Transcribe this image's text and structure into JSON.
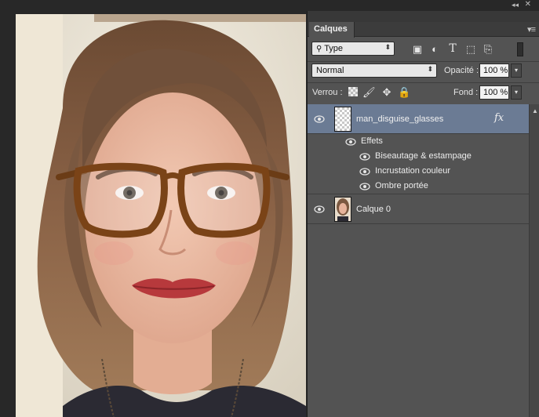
{
  "panel": {
    "tab_label": "Calques",
    "filter": {
      "kind_value": "Type"
    },
    "blend_mode": "Normal",
    "opacity_label": "Opacité :",
    "opacity_value": "100 %",
    "lock_label": "Verrou :",
    "fill_label": "Fond :",
    "fill_value": "100 %"
  },
  "layers": [
    {
      "name": "man_disguise_glasses",
      "selected": true,
      "has_fx": true,
      "fx_label": "fx",
      "effects_label": "Effets",
      "effects": [
        "Biseautage & estampage",
        "Incrustation couleur",
        "Ombre portée"
      ]
    },
    {
      "name": "Calque 0",
      "selected": false,
      "has_fx": false
    }
  ],
  "colors": {
    "panel_bg": "#535353",
    "selected_row": "#6b7b94",
    "app_bg": "#282828"
  },
  "icons": [
    "collapse-icon",
    "close-icon",
    "panel-menu-icon",
    "search-icon",
    "image-filter-icon",
    "adjustment-filter-icon",
    "type-filter-icon",
    "shape-filter-icon",
    "smart-object-filter-icon",
    "filter-toggle-icon",
    "lock-pixels-icon",
    "lock-brush-icon",
    "lock-position-icon",
    "lock-all-icon",
    "eye-icon",
    "scroll-up-icon"
  ]
}
